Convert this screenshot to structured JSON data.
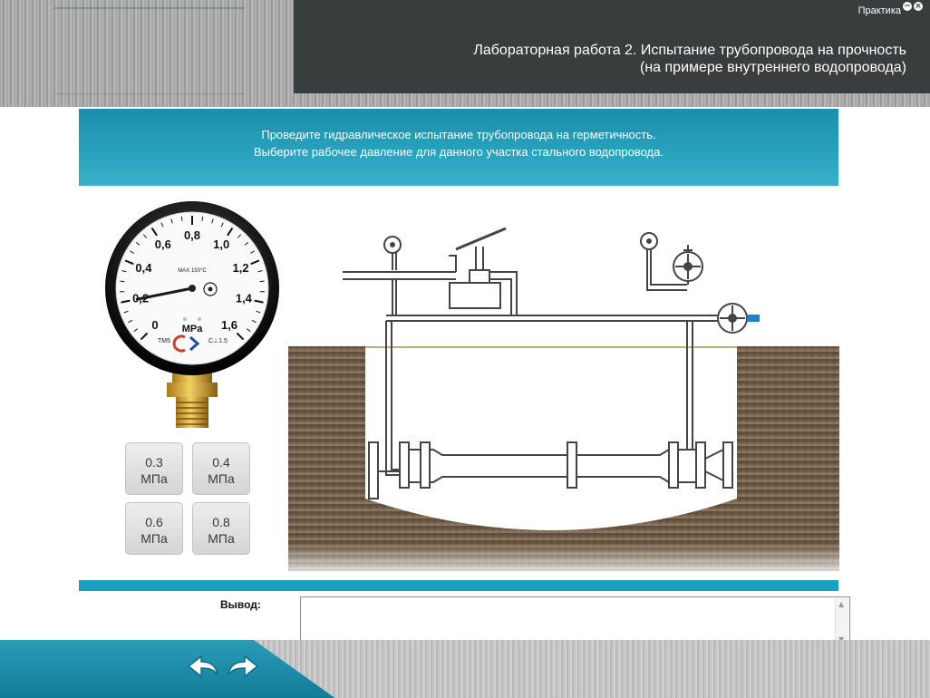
{
  "header": {
    "practice_label": "Практика",
    "minimize_glyph": "−",
    "close_glyph": "×",
    "title_line1": "Лабораторная работа 2. Испытание трубопровода на прочность",
    "title_line2": "(на примере внутреннего водопровода)"
  },
  "instruction": {
    "line1": "Проведите гидравлическое испытание трубопровода на герметичность.",
    "line2": "Выберите рабочее давление для данного участка стального водопровода."
  },
  "gauge": {
    "scale_labels": [
      "0",
      "0,2",
      "0,4",
      "0,6",
      "0,8",
      "1,0",
      "1,2",
      "1,4",
      "1,6"
    ],
    "max_temp": "MAX 150°C",
    "unit": "MPa",
    "model": "TM5",
    "accuracy": "C⊥1.5",
    "needle_value": 0.2
  },
  "answers": [
    {
      "value": "0.3",
      "unit": "МПа"
    },
    {
      "value": "0.4",
      "unit": "МПа"
    },
    {
      "value": "0.6",
      "unit": "МПа"
    },
    {
      "value": "0.8",
      "unit": "МПа"
    }
  ],
  "conclusion": {
    "label": "Вывод:",
    "value": ""
  },
  "nav": {
    "back_icon": "back-arrow-icon",
    "forward_icon": "forward-arrow-icon"
  },
  "colors": {
    "header_dark": "#3a3d3d",
    "accent_teal": "#1aa0bf",
    "pipe_blue": "#1f7fd0"
  }
}
